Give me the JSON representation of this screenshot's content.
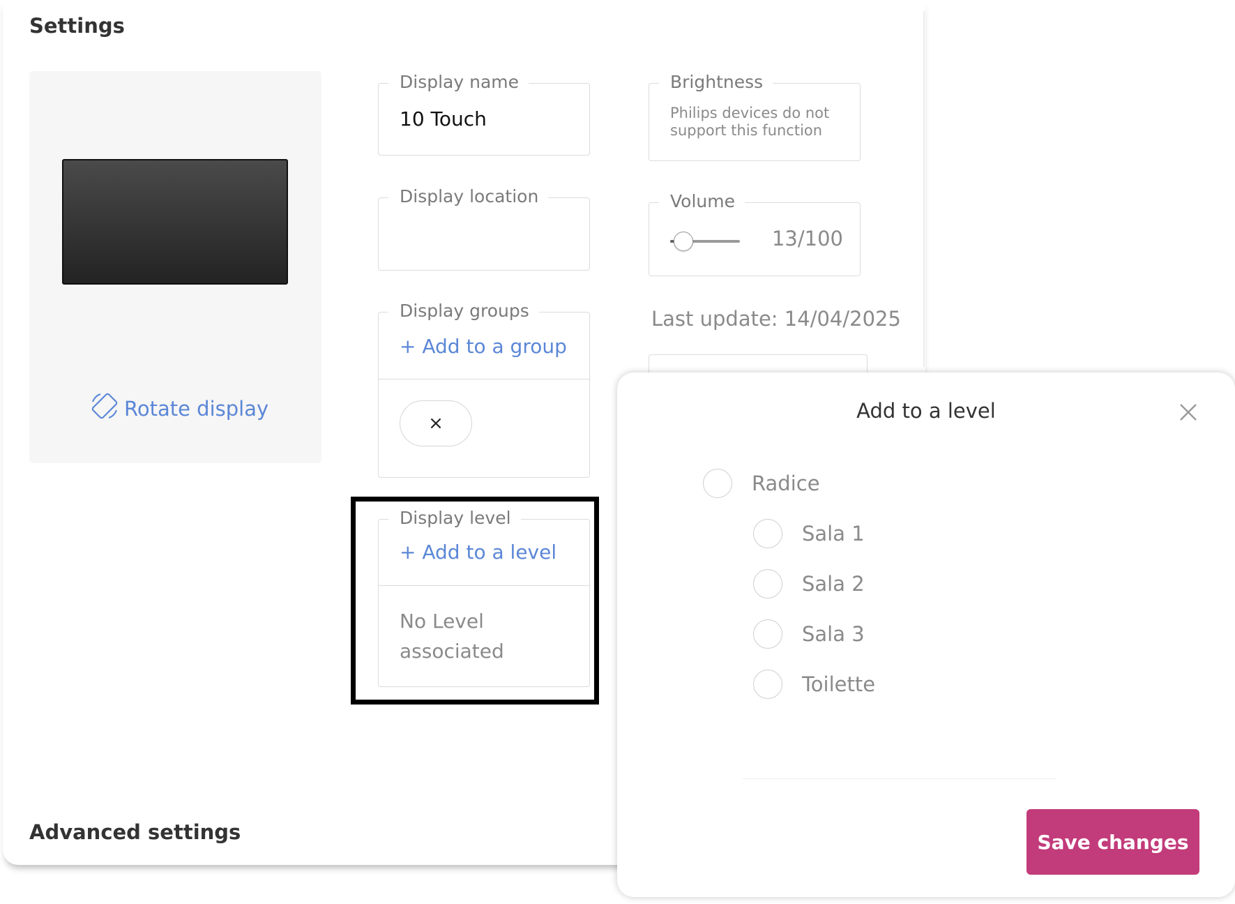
{
  "settings": {
    "title": "Settings",
    "advanced_title": "Advanced settings"
  },
  "preview": {
    "rotate_label": "Rotate display"
  },
  "display_name": {
    "label": "Display name",
    "value": "10 Touch"
  },
  "display_location": {
    "label": "Display location",
    "value": ""
  },
  "display_groups": {
    "label": "Display groups",
    "add_link": "+ Add to a group",
    "chip_close": "×"
  },
  "display_level": {
    "label": "Display level",
    "add_link": "+ Add to a level",
    "empty": "No Level associated"
  },
  "brightness": {
    "label": "Brightness",
    "note": "Philips devices do not support this function"
  },
  "volume": {
    "label": "Volume",
    "value": 13,
    "max": 100,
    "display": "13/100"
  },
  "last_update": "Last update: 14/04/2025",
  "modal": {
    "title": "Add to a level",
    "levels": [
      {
        "label": "Radice",
        "depth": 0
      },
      {
        "label": "Sala 1",
        "depth": 1
      },
      {
        "label": "Sala 2",
        "depth": 1
      },
      {
        "label": "Sala 3",
        "depth": 1
      },
      {
        "label": "Toilette",
        "depth": 1
      }
    ],
    "save_label": "Save changes"
  },
  "colors": {
    "accent_link": "#5b87d6",
    "save_button": "#c23b7a"
  }
}
